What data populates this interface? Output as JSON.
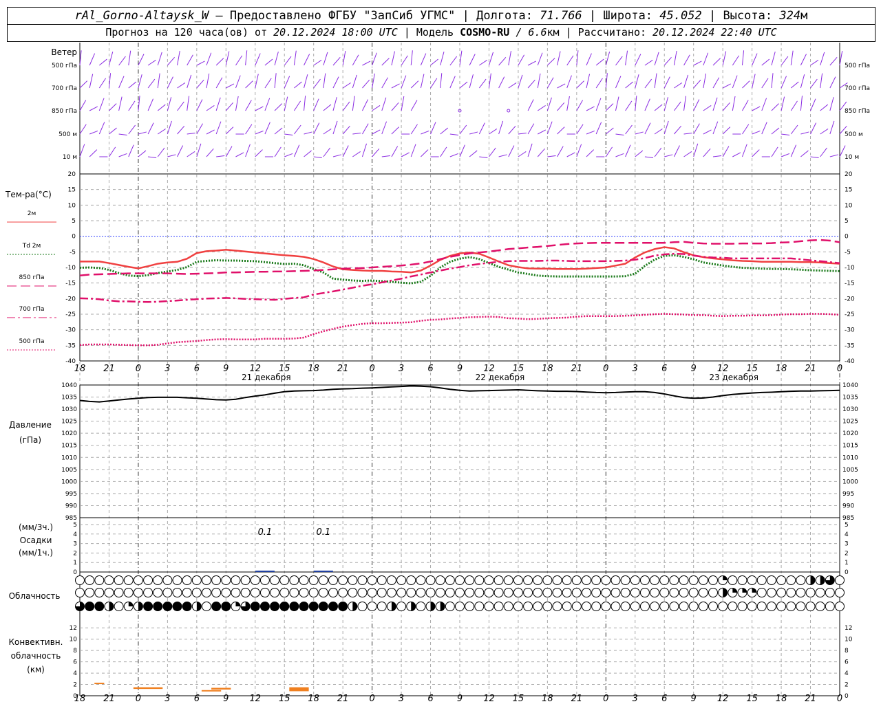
{
  "header": {
    "station": "rAl_Gorno-Altaysk_W",
    "provider": "– Предоставлено ФГБУ \"ЗапСиб УГМС\" |",
    "lon_label": "Долгота:",
    "lon": "71.766",
    "lat_label": "| Широта:",
    "lat": "45.052",
    "alt_label": "| Высота:",
    "alt": "324",
    "alt_unit": "м",
    "forecast_label": "Прогноз на 120 часа(ов) от",
    "forecast_from": "20.12.2024 18:00 UTC",
    "model_label": "| Модель",
    "model": "COSMO-RU",
    "resolution": "/ 6.6",
    "res_unit": "км",
    "computed_label": "| Рассчитано:",
    "computed": "20.12.2024 22:40 UTC"
  },
  "chart_data": {
    "type": "line",
    "x": [
      18,
      19,
      20,
      21,
      22,
      23,
      0,
      1,
      2,
      3,
      4,
      5,
      6,
      7,
      8,
      9,
      10,
      11,
      12,
      13,
      14,
      15,
      16,
      17,
      18,
      19,
      20,
      21,
      22,
      23,
      0,
      1,
      2,
      3,
      4,
      5,
      6,
      7,
      8,
      9,
      10,
      11,
      12,
      13,
      14,
      15,
      16,
      17,
      18,
      19,
      20,
      21,
      22,
      23,
      0,
      1,
      2,
      3,
      4,
      5,
      6,
      7,
      8,
      9,
      10,
      11,
      12,
      13,
      14,
      15,
      16,
      17,
      18,
      19,
      20,
      21,
      22,
      23,
      0
    ],
    "x_tick_labels": [
      "18",
      "21",
      "0",
      "3",
      "6",
      "9",
      "12",
      "15",
      "18",
      "21",
      "0",
      "3",
      "6",
      "9",
      "12",
      "15",
      "18",
      "21",
      "0",
      "3",
      "6",
      "9",
      "12",
      "15",
      "18",
      "21",
      "0"
    ],
    "day_labels": [
      "21 декабря",
      "22 декабря",
      "23 декабря"
    ],
    "wind_panel": {
      "title": "Ветер",
      "levels": [
        "500 гПа",
        "700 гПа",
        "850 гПа",
        "500 м",
        "10  м"
      ],
      "color": "#8a2be2"
    },
    "temperature": {
      "ylabel": "Тем-ра(°C)",
      "ylim": [
        -40,
        20
      ],
      "yticks": [
        20,
        15,
        10,
        5,
        0,
        -5,
        -10,
        -15,
        -20,
        -25,
        -30,
        -35,
        -40
      ],
      "series": [
        {
          "name": "2м",
          "color": "#f04040",
          "style": "solid",
          "values": [
            -8.1,
            -8.1,
            -8.1,
            -8.6,
            -9.2,
            -9.8,
            -10.3,
            -9.6,
            -8.8,
            -8.4,
            -8.2,
            -7.2,
            -5.4,
            -4.8,
            -4.6,
            -4.3,
            -4.6,
            -4.9,
            -5.2,
            -5.5,
            -5.8,
            -6.1,
            -6.3,
            -6.6,
            -7.3,
            -8.4,
            -9.7,
            -10.6,
            -10.8,
            -11.0,
            -11.1,
            -11.1,
            -11.3,
            -11.4,
            -11.6,
            -11.0,
            -9.4,
            -7.6,
            -6.3,
            -5.5,
            -5.2,
            -5.6,
            -6.8,
            -8.1,
            -9.3,
            -9.9,
            -10.3,
            -10.4,
            -10.4,
            -10.5,
            -10.5,
            -10.5,
            -10.4,
            -10.2,
            -10.0,
            -9.4,
            -8.8,
            -6.8,
            -5.2,
            -4.1,
            -3.5,
            -3.9,
            -5.1,
            -6.1,
            -6.7,
            -7.1,
            -7.4,
            -7.7,
            -7.9,
            -8.0,
            -8.2,
            -8.2,
            -8.2,
            -8.2,
            -8.3,
            -8.3,
            -8.4,
            -8.6,
            -8.8
          ]
        },
        {
          "name": "Td  2м",
          "color": "#1a7a1a",
          "style": "dotted",
          "values": [
            -10.1,
            -10.0,
            -10.2,
            -10.8,
            -11.8,
            -12.6,
            -12.8,
            -12.5,
            -11.8,
            -11.3,
            -10.8,
            -9.9,
            -8.2,
            -7.9,
            -7.7,
            -7.8,
            -7.8,
            -7.9,
            -8.0,
            -8.3,
            -8.6,
            -8.9,
            -8.8,
            -9.3,
            -10.5,
            -11.6,
            -13.6,
            -13.9,
            -14.2,
            -14.3,
            -14.2,
            -14.4,
            -14.6,
            -14.9,
            -15.1,
            -14.6,
            -12.7,
            -10.0,
            -8.2,
            -7.2,
            -6.7,
            -7.3,
            -8.6,
            -9.8,
            -10.7,
            -11.6,
            -12.1,
            -12.6,
            -12.8,
            -12.9,
            -12.9,
            -12.9,
            -12.9,
            -12.9,
            -12.9,
            -12.9,
            -12.8,
            -12.0,
            -9.5,
            -7.5,
            -6.3,
            -6.1,
            -6.6,
            -7.4,
            -8.4,
            -8.9,
            -9.4,
            -9.8,
            -10.1,
            -10.2,
            -10.4,
            -10.5,
            -10.5,
            -10.6,
            -10.7,
            -10.9,
            -11.0,
            -11.1,
            -11.2
          ]
        },
        {
          "name": "850 гПа",
          "color": "#e0106a",
          "style": "dashed",
          "values": [
            -12.6,
            -12.3,
            -12.2,
            -12.1,
            -12.0,
            -11.9,
            -11.9,
            -11.9,
            -11.9,
            -11.9,
            -12.0,
            -12.1,
            -12.0,
            -11.9,
            -11.8,
            -11.6,
            -11.6,
            -11.5,
            -11.4,
            -11.4,
            -11.3,
            -11.3,
            -11.2,
            -11.1,
            -11.0,
            -10.8,
            -10.6,
            -10.4,
            -10.3,
            -10.2,
            -10.0,
            -9.8,
            -9.6,
            -9.4,
            -9.1,
            -8.7,
            -8.1,
            -7.3,
            -6.6,
            -6.0,
            -5.5,
            -5.2,
            -4.9,
            -4.5,
            -4.1,
            -3.9,
            -3.6,
            -3.4,
            -3.1,
            -2.8,
            -2.5,
            -2.3,
            -2.2,
            -2.1,
            -2.1,
            -2.1,
            -2.1,
            -2.1,
            -2.1,
            -2.1,
            -2.1,
            -1.9,
            -1.8,
            -2.1,
            -2.3,
            -2.4,
            -2.4,
            -2.4,
            -2.3,
            -2.3,
            -2.3,
            -2.2,
            -2.0,
            -1.9,
            -1.6,
            -1.3,
            -1.2,
            -1.4,
            -1.9
          ]
        },
        {
          "name": "700 гПа",
          "color": "#e0106a",
          "style": "dashdot",
          "values": [
            -19.9,
            -20.0,
            -20.2,
            -20.6,
            -20.9,
            -20.9,
            -21.0,
            -21.1,
            -21.0,
            -20.8,
            -20.6,
            -20.4,
            -20.2,
            -20.0,
            -19.9,
            -19.8,
            -19.9,
            -20.1,
            -20.2,
            -20.3,
            -20.4,
            -20.1,
            -19.8,
            -19.6,
            -18.7,
            -18.2,
            -17.7,
            -17.1,
            -16.5,
            -15.9,
            -15.4,
            -14.8,
            -14.2,
            -13.6,
            -12.9,
            -12.3,
            -11.6,
            -11.0,
            -10.4,
            -9.9,
            -9.3,
            -8.9,
            -8.5,
            -8.2,
            -8.0,
            -7.9,
            -7.9,
            -7.9,
            -7.8,
            -7.8,
            -7.9,
            -8.0,
            -8.0,
            -8.0,
            -8.0,
            -7.9,
            -7.8,
            -7.5,
            -7.0,
            -6.2,
            -5.8,
            -5.6,
            -5.7,
            -6.2,
            -6.6,
            -6.8,
            -6.9,
            -7.1,
            -7.1,
            -7.1,
            -7.1,
            -7.1,
            -7.1,
            -7.1,
            -7.4,
            -7.7,
            -8.0,
            -8.3,
            -8.6
          ]
        },
        {
          "name": "500 гПа",
          "color": "#e0106a",
          "style": "dotted",
          "values": [
            -34.9,
            -34.7,
            -34.7,
            -34.7,
            -34.8,
            -34.9,
            -35.0,
            -35.0,
            -34.8,
            -34.4,
            -34.0,
            -33.8,
            -33.6,
            -33.3,
            -33.1,
            -33.0,
            -33.1,
            -33.1,
            -33.1,
            -32.9,
            -32.9,
            -32.9,
            -32.8,
            -32.5,
            -31.4,
            -30.5,
            -29.7,
            -29.0,
            -28.5,
            -28.1,
            -27.9,
            -27.9,
            -27.8,
            -27.7,
            -27.6,
            -27.1,
            -26.8,
            -26.7,
            -26.4,
            -26.2,
            -26.0,
            -25.9,
            -25.8,
            -25.9,
            -26.3,
            -26.4,
            -26.6,
            -26.5,
            -26.3,
            -26.2,
            -26.1,
            -25.8,
            -25.6,
            -25.6,
            -25.6,
            -25.6,
            -25.5,
            -25.4,
            -25.2,
            -25.0,
            -24.9,
            -25.0,
            -25.1,
            -25.3,
            -25.3,
            -25.5,
            -25.6,
            -25.5,
            -25.5,
            -25.4,
            -25.4,
            -25.3,
            -25.1,
            -25.0,
            -25.0,
            -24.9,
            -24.9,
            -25.0,
            -25.2
          ]
        }
      ]
    },
    "pressure": {
      "ylabel": "Давление",
      "unit": "(гПа)",
      "ylim": [
        985,
        1040
      ],
      "yticks": [
        1040,
        1035,
        1030,
        1025,
        1020,
        1015,
        1010,
        1005,
        1000,
        995,
        990,
        985
      ],
      "values": [
        1033.6,
        1033.2,
        1033.0,
        1033.4,
        1033.8,
        1034.2,
        1034.5,
        1034.8,
        1034.9,
        1034.9,
        1034.9,
        1034.7,
        1034.5,
        1034.2,
        1033.9,
        1033.8,
        1034.1,
        1034.8,
        1035.4,
        1035.9,
        1036.6,
        1037.2,
        1037.5,
        1037.6,
        1037.7,
        1037.9,
        1038.2,
        1038.4,
        1038.5,
        1038.7,
        1038.8,
        1039.0,
        1039.2,
        1039.4,
        1039.6,
        1039.5,
        1039.3,
        1038.8,
        1038.2,
        1037.8,
        1037.5,
        1037.6,
        1037.7,
        1037.8,
        1037.9,
        1038.0,
        1037.8,
        1037.6,
        1037.5,
        1037.4,
        1037.4,
        1037.3,
        1037.1,
        1036.9,
        1036.8,
        1036.9,
        1037.1,
        1037.2,
        1037.2,
        1036.9,
        1036.3,
        1035.5,
        1034.8,
        1034.5,
        1034.6,
        1035.0,
        1035.6,
        1036.1,
        1036.4,
        1036.7,
        1036.9,
        1037.0,
        1037.2,
        1037.4,
        1037.5,
        1037.5,
        1037.6,
        1037.7,
        1037.8
      ]
    },
    "precipitation": {
      "ylabel_top": "(мм/3ч.)",
      "ylabel_mid": "Осадки",
      "ylabel_bot": "(мм/1ч.)",
      "ylim": [
        0,
        5
      ],
      "yticks": [
        5,
        4,
        3,
        2,
        1,
        0
      ],
      "events": [
        {
          "hour_index": 19,
          "value": "0.1"
        },
        {
          "hour_index": 25,
          "value": "0.1"
        }
      ]
    },
    "clouds": {
      "ylabel": "Облачность",
      "rows": [
        {
          "level": "high",
          "partial": [
            {
              "i": 66,
              "f": 0.25
            },
            {
              "i": 75,
              "f": 0.5
            },
            {
              "i": 76,
              "f": 0.5
            },
            {
              "i": 77,
              "f": 0.75
            }
          ]
        },
        {
          "level": "mid",
          "partial": [
            {
              "i": 66,
              "f": 0.5
            },
            {
              "i": 67,
              "f": 0.25
            },
            {
              "i": 68,
              "f": 0.25
            },
            {
              "i": 69,
              "f": 0.25
            }
          ]
        },
        {
          "level": "low",
          "partial": [
            {
              "i": 0,
              "f": 0.75
            },
            {
              "i": 1,
              "f": 1
            },
            {
              "i": 2,
              "f": 1
            },
            {
              "i": 3,
              "f": 0.5
            },
            {
              "i": 5,
              "f": 0.25
            },
            {
              "i": 6,
              "f": 0.5
            },
            {
              "i": 7,
              "f": 1
            },
            {
              "i": 8,
              "f": 1
            },
            {
              "i": 9,
              "f": 1
            },
            {
              "i": 10,
              "f": 1
            },
            {
              "i": 11,
              "f": 1
            },
            {
              "i": 12,
              "f": 0.5
            },
            {
              "i": 14,
              "f": 1
            },
            {
              "i": 15,
              "f": 1
            },
            {
              "i": 16,
              "f": 0.25
            },
            {
              "i": 17,
              "f": 0.75
            },
            {
              "i": 18,
              "f": 1
            },
            {
              "i": 19,
              "f": 1
            },
            {
              "i": 20,
              "f": 1
            },
            {
              "i": 21,
              "f": 1
            },
            {
              "i": 22,
              "f": 1
            },
            {
              "i": 23,
              "f": 1
            },
            {
              "i": 24,
              "f": 1
            },
            {
              "i": 25,
              "f": 1
            },
            {
              "i": 26,
              "f": 1
            },
            {
              "i": 27,
              "f": 1
            },
            {
              "i": 28,
              "f": 0.5
            },
            {
              "i": 32,
              "f": 0.5
            },
            {
              "i": 34,
              "f": 0.5
            },
            {
              "i": 36,
              "f": 0.5
            },
            {
              "i": 37,
              "f": 0.5
            }
          ]
        }
      ]
    },
    "convective": {
      "ylabel1": "Конвективн.",
      "ylabel2": "облачность",
      "ylabel3": "(км)",
      "ylim": [
        0,
        13
      ],
      "yticks": [
        12,
        10,
        8,
        6,
        4,
        2,
        0
      ],
      "color": "#f08020",
      "bars": [
        {
          "start": 1.5,
          "end": 2.5,
          "bottom": 2.1,
          "top": 2.3
        },
        {
          "start": 5.5,
          "end": 8.5,
          "bottom": 1.2,
          "top": 1.5
        },
        {
          "start": 12.5,
          "end": 14.5,
          "bottom": 0.9,
          "top": 1.0
        },
        {
          "start": 13.5,
          "end": 15.5,
          "bottom": 1.1,
          "top": 1.4
        },
        {
          "start": 21.5,
          "end": 23.5,
          "bottom": 0.8,
          "top": 1.5
        }
      ]
    }
  }
}
